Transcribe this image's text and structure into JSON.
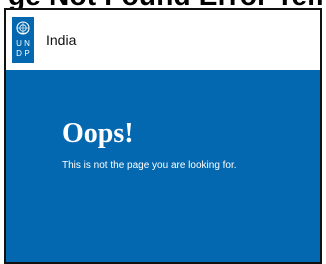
{
  "top_caption_partial": "ge Not Found Error Template by",
  "header": {
    "logo": {
      "icon": "un-emblem-icon",
      "letters": [
        "U",
        "N",
        "D",
        "P"
      ]
    },
    "country_label": "India"
  },
  "error": {
    "title": "Oops!",
    "message": "This is not the page you are looking for."
  },
  "colors": {
    "brand_blue": "#0468b1",
    "header_bg": "#ffffff",
    "text_dark": "#111111",
    "text_light": "#ffffff"
  }
}
